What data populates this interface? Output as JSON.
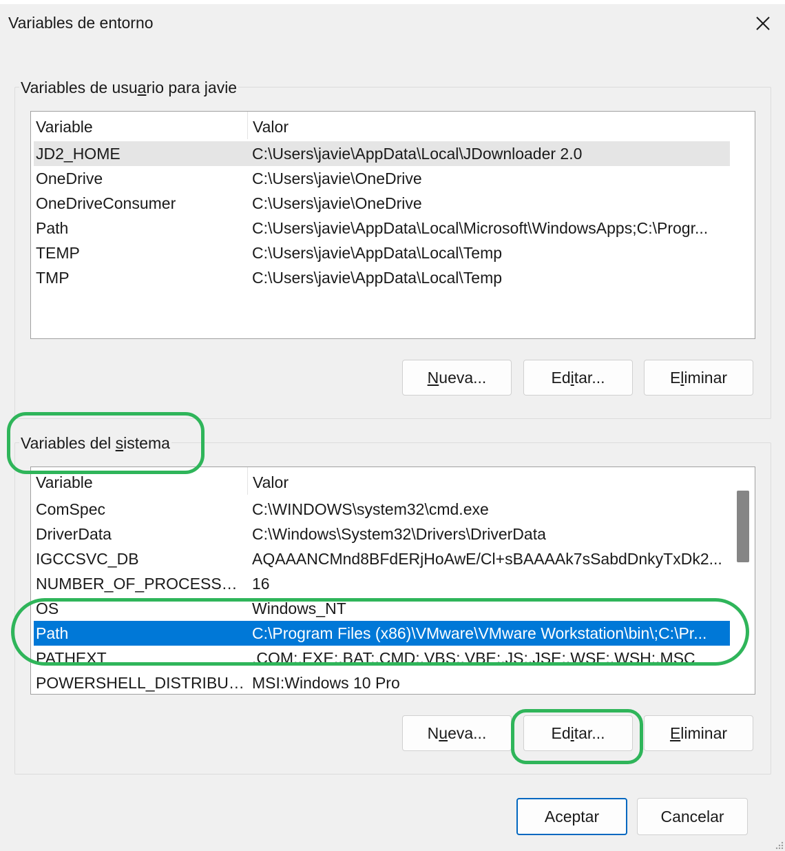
{
  "window": {
    "title": "Variables de entorno",
    "close_icon": "close-icon"
  },
  "user_group": {
    "label_pre": "Variables de usu",
    "label_acc": "a",
    "label_post": "rio para javie",
    "header": {
      "variable": "Variable",
      "valor": "Valor"
    },
    "rows": [
      {
        "variable": "JD2_HOME",
        "valor": "C:\\Users\\javie\\AppData\\Local\\JDownloader 2.0",
        "state": "hover"
      },
      {
        "variable": "OneDrive",
        "valor": "C:\\Users\\javie\\OneDrive"
      },
      {
        "variable": "OneDriveConsumer",
        "valor": "C:\\Users\\javie\\OneDrive"
      },
      {
        "variable": "Path",
        "valor": "C:\\Users\\javie\\AppData\\Local\\Microsoft\\WindowsApps;C:\\Progr..."
      },
      {
        "variable": "TEMP",
        "valor": "C:\\Users\\javie\\AppData\\Local\\Temp"
      },
      {
        "variable": "TMP",
        "valor": "C:\\Users\\javie\\AppData\\Local\\Temp"
      }
    ],
    "buttons": {
      "nueva": {
        "acc": "N",
        "rest": "ueva..."
      },
      "editar": {
        "pre": "Ed",
        "acc": "i",
        "rest": "tar..."
      },
      "eliminar": {
        "pre": "E",
        "acc": "l",
        "rest": "iminar"
      }
    }
  },
  "system_group": {
    "label_pre": "Variables del ",
    "label_acc": "s",
    "label_post": "istema",
    "header": {
      "variable": "Variable",
      "valor": "Valor"
    },
    "rows": [
      {
        "variable": "ComSpec",
        "valor": "C:\\WINDOWS\\system32\\cmd.exe"
      },
      {
        "variable": "DriverData",
        "valor": "C:\\Windows\\System32\\Drivers\\DriverData"
      },
      {
        "variable": "IGCCSVC_DB",
        "valor": "AQAAANCMnd8BFdERjHoAwE/Cl+sBAAAAk7sSabdDnkyTxDk2..."
      },
      {
        "variable": "NUMBER_OF_PROCESSORS",
        "valor": "16"
      },
      {
        "variable": "OS",
        "valor": "Windows_NT"
      },
      {
        "variable": "Path",
        "valor": "C:\\Program Files (x86)\\VMware\\VMware Workstation\\bin\\;C:\\Pr...",
        "state": "selected"
      },
      {
        "variable": "PATHEXT",
        "valor": ".COM;.EXE;.BAT;.CMD;.VBS;.VBE;.JS;.JSE;.WSF;.WSH;.MSC"
      },
      {
        "variable": "POWERSHELL_DISTRIBUTIO...",
        "valor": "MSI:Windows 10 Pro"
      }
    ],
    "buttons": {
      "nueva": {
        "pre": "N",
        "acc": "u",
        "rest": "eva..."
      },
      "editar": {
        "pre": "Ed",
        "acc": "i",
        "rest": "tar..."
      },
      "eliminar": {
        "pre": "",
        "acc": "E",
        "rest": "liminar"
      }
    }
  },
  "footer": {
    "aceptar": "Aceptar",
    "cancelar": "Cancelar"
  },
  "colors": {
    "selection": "#0078d7",
    "annotation": "#2fb55a",
    "dialog_bg": "#f0f0f0"
  }
}
